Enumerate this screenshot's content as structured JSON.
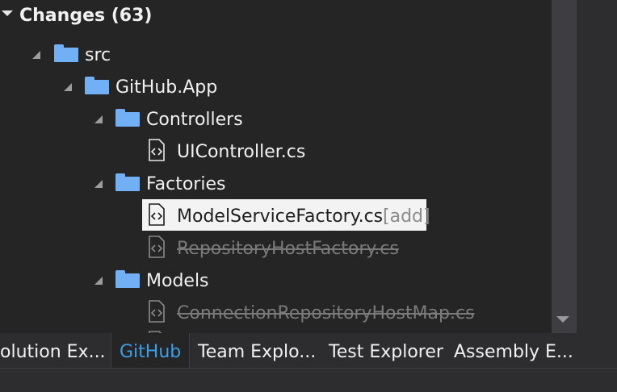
{
  "changes": {
    "title": "Changes (63)",
    "tree": {
      "src": "src",
      "github_app": "GitHub.App",
      "controllers": "Controllers",
      "ui_controller": "UIController.cs",
      "factories": "Factories",
      "model_service_factory": "ModelServiceFactory.cs",
      "model_service_factory_status": "[add]",
      "repository_host_factory": "RepositoryHostFactory.cs",
      "models": "Models",
      "connection_repository_host_map": "ConnectionRepositoryHostMap.cs"
    }
  },
  "tabs": [
    {
      "label": "olution Ex..."
    },
    {
      "label": "GitHub"
    },
    {
      "label": "Team Explo..."
    },
    {
      "label": "Test Explorer"
    },
    {
      "label": "Assembly E..."
    }
  ],
  "colors": {
    "background": "#252526",
    "folder": "#72b0f5",
    "active_tab_text": "#3c9ee6",
    "selection": "#f3f3f3"
  }
}
